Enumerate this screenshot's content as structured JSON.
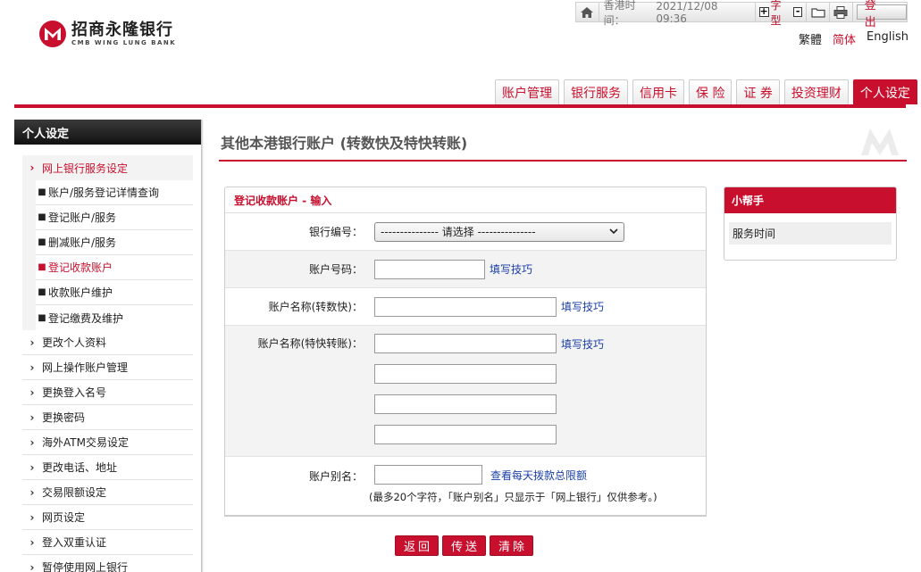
{
  "topbar": {
    "time_label": "香港时间：",
    "time_value": "2021/12/08 09:36",
    "font_label": "字型",
    "font_increase": "+",
    "font_decrease": "-",
    "logout": "登 出"
  },
  "logo": {
    "cn": "招商永隆银行",
    "en": "CMB WING LUNG BANK"
  },
  "language": {
    "traditional": "繁體",
    "simplified": "简体",
    "english": "English"
  },
  "nav": {
    "tabs": [
      {
        "label": "账户管理",
        "active": false
      },
      {
        "label": "银行服务",
        "active": false
      },
      {
        "label": "信用卡",
        "active": false
      },
      {
        "label": "保 险",
        "active": false
      },
      {
        "label": "证 券",
        "active": false
      },
      {
        "label": "投资理财",
        "active": false
      },
      {
        "label": "个人设定",
        "active": true
      }
    ]
  },
  "sidebar": {
    "title": "个人设定",
    "group": {
      "label": "网上银行服务设定",
      "items": [
        {
          "label": "账户/服务登记详情查询",
          "active": false
        },
        {
          "label": "登记账户/服务",
          "active": false
        },
        {
          "label": "删减账户/服务",
          "active": false
        },
        {
          "label": "登记收款账户",
          "active": true
        },
        {
          "label": "收款账户维护",
          "active": false
        },
        {
          "label": "登记缴费及维护",
          "active": false
        }
      ]
    },
    "items": [
      "更改个人资料",
      "网上操作账户管理",
      "更换登入名号",
      "更换密码",
      "海外ATM交易设定",
      "更改电话、地址",
      "交易限额设定",
      "网页设定",
      "登入双重认证",
      "暂停使用网上银行"
    ]
  },
  "page": {
    "title": "其他本港银行账户 (转数快及特快转账)"
  },
  "form": {
    "header": "登记收款账户 - 输入",
    "bank_code_label": "银行编号：",
    "bank_select_value": "--------------- 请选择 ---------------",
    "account_number_label": "账户号码：",
    "account_name_fps_label": "账户名称(转数快)：",
    "account_name_chats_label": "账户名称(特快转账)：",
    "alias_label": "账户别名：",
    "fill_tip": "填写技巧",
    "daily_limit_link": "查看每天拨款总限额",
    "alias_note": "(最多20个字符，「账户别名」只显示于「网上银行」仅供参考。)"
  },
  "buttons": {
    "back": "返回",
    "send": "传送",
    "clear": "清除"
  },
  "helper": {
    "title": "小帮手",
    "item": "服务时间"
  },
  "colors": {
    "brand_red": "#c8102e",
    "link_blue": "#1a3fa8"
  }
}
